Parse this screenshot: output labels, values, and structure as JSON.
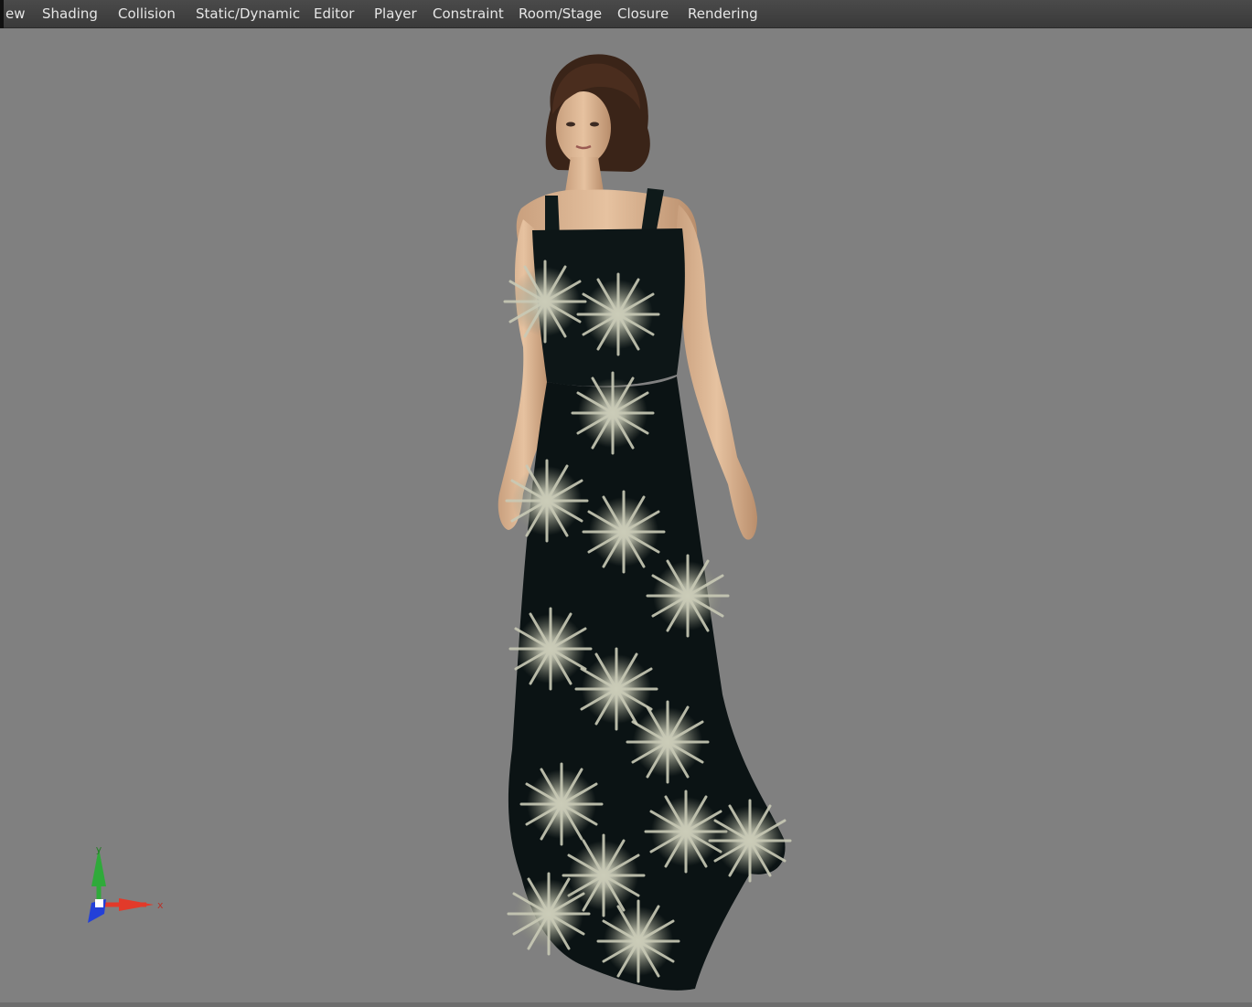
{
  "menubar": {
    "items": [
      {
        "label": "ew"
      },
      {
        "label": "Shading"
      },
      {
        "label": "Collision"
      },
      {
        "label": "Static/Dynamic"
      },
      {
        "label": "Editor"
      },
      {
        "label": "Player"
      },
      {
        "label": "Constraint"
      },
      {
        "label": "Room/Stage"
      },
      {
        "label": "Closure"
      },
      {
        "label": "Rendering"
      }
    ]
  },
  "viewport": {
    "background_color": "#808080",
    "model": "woman-in-floral-maxi-dress",
    "axis_gizmo": {
      "y_label": "y",
      "x_label": "x",
      "y_color": "#2faa3a",
      "x_color": "#e23a2a",
      "z_color": "#2340d8"
    }
  }
}
